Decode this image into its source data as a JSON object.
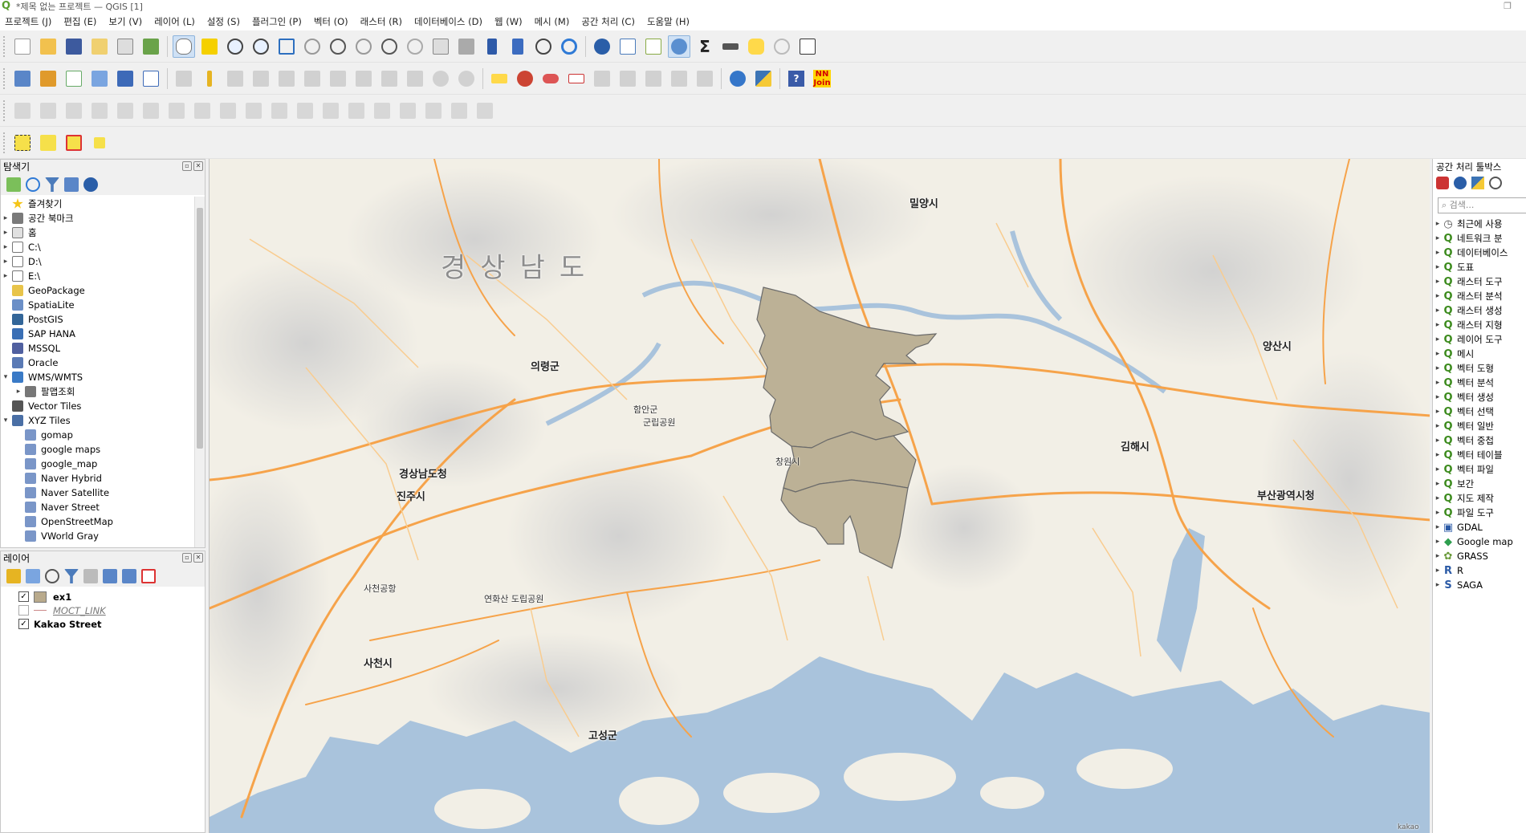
{
  "window": {
    "title": "*제목 없는 프로젝트 — QGIS [1]",
    "restore_glyph": "❐"
  },
  "menu": [
    "프로젝트 (J)",
    "편집 (E)",
    "보기 (V)",
    "레이어 (L)",
    "설정 (S)",
    "플러그인 (P)",
    "벡터 (O)",
    "래스터 (R)",
    "데이터베이스 (D)",
    "웹 (W)",
    "메시 (M)",
    "공간 처리 (C)",
    "도움말 (H)"
  ],
  "toolbar_plugins": {
    "nnjoin_label": "NN Join",
    "help_label": "?"
  },
  "browser": {
    "title": "탐색기",
    "items": [
      {
        "label": "즐겨찾기",
        "icon": "star-icon"
      },
      {
        "label": "공간 북마크",
        "icon": "bookmark-icon"
      },
      {
        "label": "홈",
        "icon": "home-folder-icon"
      },
      {
        "label": "C:\\",
        "icon": "drive-icon"
      },
      {
        "label": "D:\\",
        "icon": "drive-icon"
      },
      {
        "label": "E:\\",
        "icon": "drive-icon"
      },
      {
        "label": "GeoPackage",
        "icon": "geopackage-icon"
      },
      {
        "label": "SpatiaLite",
        "icon": "spatialite-icon"
      },
      {
        "label": "PostGIS",
        "icon": "postgis-icon"
      },
      {
        "label": "SAP HANA",
        "icon": "sap-hana-icon"
      },
      {
        "label": "MSSQL",
        "icon": "mssql-icon"
      },
      {
        "label": "Oracle",
        "icon": "oracle-icon"
      },
      {
        "label": "WMS/WMTS",
        "icon": "wms-icon"
      },
      {
        "label": "팔맵조회",
        "icon": "wms-layer-icon"
      },
      {
        "label": "Vector Tiles",
        "icon": "vector-tiles-icon"
      },
      {
        "label": "XYZ Tiles",
        "icon": "xyz-tiles-icon"
      },
      {
        "label": "gomap",
        "icon": "xyz-layer-icon"
      },
      {
        "label": "google maps",
        "icon": "xyz-layer-icon"
      },
      {
        "label": "google_map",
        "icon": "xyz-layer-icon"
      },
      {
        "label": "Naver Hybrid",
        "icon": "xyz-layer-icon"
      },
      {
        "label": "Naver Satellite",
        "icon": "xyz-layer-icon"
      },
      {
        "label": "Naver Street",
        "icon": "xyz-layer-icon"
      },
      {
        "label": "OpenStreetMap",
        "icon": "xyz-layer-icon"
      },
      {
        "label": "VWorld Gray",
        "icon": "xyz-layer-icon"
      }
    ]
  },
  "layers": {
    "title": "레이어",
    "items": [
      {
        "label": "ex1",
        "checked": true,
        "swatch": "#b9aa8c",
        "check_glyph": "✓"
      },
      {
        "label": "MOCT_LINK",
        "checked": false,
        "swatch": "line",
        "check_glyph": ""
      },
      {
        "label": "Kakao Street",
        "checked": true,
        "swatch": "none",
        "check_glyph": "✓"
      }
    ]
  },
  "processing": {
    "title": "공간 처리 툴박스",
    "search_placeholder": "검색...",
    "items": [
      {
        "label": "최근에 사용",
        "icon": "clock-icon"
      },
      {
        "label": "네트워크 분",
        "icon": "qgis-icon"
      },
      {
        "label": "데이터베이스",
        "icon": "qgis-icon"
      },
      {
        "label": "도표",
        "icon": "qgis-icon"
      },
      {
        "label": "래스터 도구",
        "icon": "qgis-icon"
      },
      {
        "label": "래스터 분석",
        "icon": "qgis-icon"
      },
      {
        "label": "래스터 생성",
        "icon": "qgis-icon"
      },
      {
        "label": "래스터 지형",
        "icon": "qgis-icon"
      },
      {
        "label": "레이어 도구",
        "icon": "qgis-icon"
      },
      {
        "label": "메시",
        "icon": "qgis-icon"
      },
      {
        "label": "벡터 도형",
        "icon": "qgis-icon"
      },
      {
        "label": "벡터 분석",
        "icon": "qgis-icon"
      },
      {
        "label": "벡터 생성",
        "icon": "qgis-icon"
      },
      {
        "label": "벡터 선택",
        "icon": "qgis-icon"
      },
      {
        "label": "벡터 일반",
        "icon": "qgis-icon"
      },
      {
        "label": "벡터 중첩",
        "icon": "qgis-icon"
      },
      {
        "label": "벡터 테이블",
        "icon": "qgis-icon"
      },
      {
        "label": "벡터 파일",
        "icon": "qgis-icon"
      },
      {
        "label": "보간",
        "icon": "qgis-icon"
      },
      {
        "label": "지도 제작",
        "icon": "qgis-icon"
      },
      {
        "label": "파일 도구",
        "icon": "qgis-icon"
      },
      {
        "label": "GDAL",
        "icon": "gdal-icon"
      },
      {
        "label": "Google map",
        "icon": "google-map-icon"
      },
      {
        "label": "GRASS",
        "icon": "grass-icon"
      },
      {
        "label": "R",
        "icon": "r-icon"
      },
      {
        "label": "SAGA",
        "icon": "saga-icon"
      }
    ]
  },
  "map": {
    "province_label": "경상남도",
    "labels": [
      "밀양시",
      "양산시",
      "김해시",
      "부산광역시청",
      "창원시",
      "진주시",
      "경상남도청",
      "의령군",
      "함안군",
      "군립공원",
      "사천시",
      "고성군",
      "사천공항",
      "연화산 도립공원",
      "kakao"
    ],
    "polygon_fill": "#bcb196",
    "sea_color": "#a9c3dc",
    "land_color": "#f2efe6",
    "road_color": "#f6a34a"
  },
  "colors": {
    "accent": "#5a9e2f",
    "toolbar_bg": "#f0f0f0"
  }
}
